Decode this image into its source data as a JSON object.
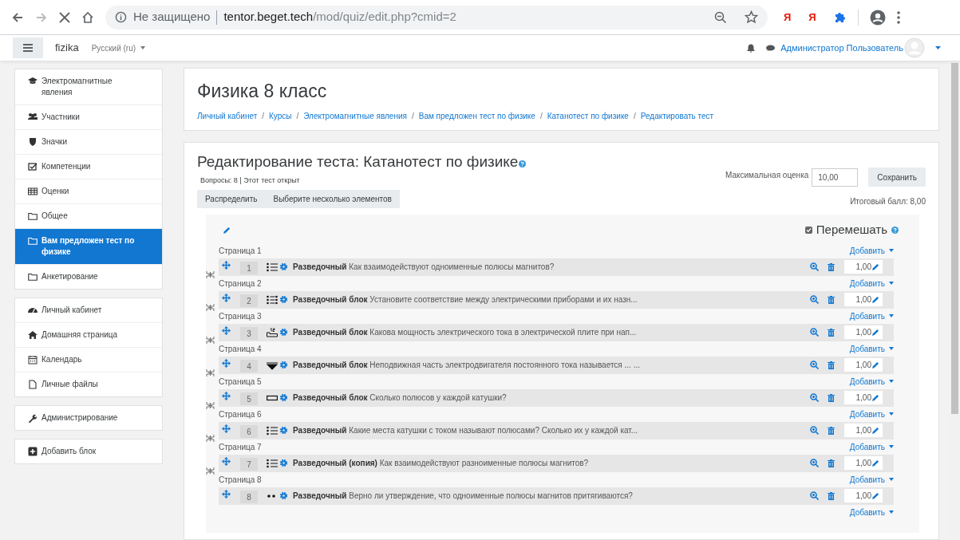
{
  "browser": {
    "security": "Не защищено",
    "host": "tentor.beget.tech",
    "path": "/mod/quiz/edit.php?cmid=2",
    "extensions": [
      {
        "label": "Я",
        "kind": "text"
      },
      {
        "label": "Я",
        "kind": "text"
      },
      {
        "kind": "puzzle"
      }
    ]
  },
  "navbar": {
    "site": "fizika",
    "language": "Русский (ru)",
    "user": "Администратор Пользователь"
  },
  "sidebar": {
    "groups": [
      {
        "items": [
          {
            "label": "Электромагнитные явления",
            "kind": "cap",
            "selected": false
          },
          {
            "label": "Участники",
            "kind": "users",
            "selected": false
          },
          {
            "label": "Значки",
            "kind": "shield",
            "selected": false
          },
          {
            "label": "Компетенции",
            "kind": "check",
            "selected": false
          },
          {
            "label": "Оценки",
            "kind": "table",
            "selected": false
          },
          {
            "label": "Общее",
            "kind": "folder",
            "selected": false
          },
          {
            "label": "Вам предложен тест по физике",
            "kind": "folder",
            "selected": true
          },
          {
            "label": "Анкетирование",
            "kind": "folder",
            "selected": false
          }
        ]
      },
      {
        "items": [
          {
            "label": "Личный кабинет",
            "kind": "gauge",
            "selected": false
          },
          {
            "label": "Домашняя страница",
            "kind": "home",
            "selected": false
          },
          {
            "label": "Календарь",
            "kind": "calendar",
            "selected": false
          },
          {
            "label": "Личные файлы",
            "kind": "file",
            "selected": false
          }
        ]
      },
      {
        "items": [
          {
            "label": "Администрирование",
            "kind": "wrench",
            "selected": false
          }
        ]
      },
      {
        "items": [
          {
            "label": "Добавить блок",
            "kind": "plus",
            "selected": false
          }
        ]
      }
    ]
  },
  "header": {
    "title": "Физика 8 класс",
    "breadcrumb_separator": "/",
    "breadcrumbs": [
      "Личный кабинет",
      "Курсы",
      "Электромагнитные явления",
      "Вам предложен тест по физике",
      "Катанотест по физике",
      "Редактировать тест"
    ]
  },
  "quiz": {
    "title": "Редактирование теста: Катанотест по физике",
    "summary": "Вопросы: 8 | Этот тест открыт",
    "buttons": [
      "Распределить",
      "Выберите несколько элементов"
    ],
    "max_grade_label": "Максимальная оценка",
    "max_grade": "10,00",
    "save": "Сохранить",
    "total": "Итоговый балл: 8,00",
    "shuffle": {
      "label": "Перемешать",
      "checked": true
    },
    "pages": [
      {
        "label": "Страница 1",
        "add": "Добавить",
        "question": {
          "number": "1",
          "kind": "multichoice",
          "name": "Разведочный",
          "text": "Как взаимодействуют одноименные полюсы магнитов?",
          "mark": "1,00"
        }
      },
      {
        "label": "Страница 2",
        "add": "Добавить",
        "question": {
          "number": "2",
          "kind": "match",
          "name": "Разведочный блок",
          "text": "Установите соответствие между электрическими приборами и их назн...",
          "mark": "1,00"
        }
      },
      {
        "label": "Страница 3",
        "add": "Добавить",
        "question": {
          "number": "3",
          "kind": "numerical",
          "name": "Разведочный блок",
          "text": "Какова мощность электрического тока в электрической плите при нап...",
          "mark": "1,00"
        }
      },
      {
        "label": "Страница 4",
        "add": "Добавить",
        "question": {
          "number": "4",
          "kind": "select",
          "name": "Разведочный блок",
          "text": "Неподвижная часть электродвигателя постоянного тока называется ... ...",
          "mark": "1,00"
        }
      },
      {
        "label": "Страница 5",
        "add": "Добавить",
        "question": {
          "number": "5",
          "kind": "shortanswer",
          "name": "Разведочный блок",
          "text": "Сколько полюсов у каждой катушки?",
          "mark": "1,00"
        }
      },
      {
        "label": "Страница 6",
        "add": "Добавить",
        "question": {
          "number": "6",
          "kind": "multichoice",
          "name": "Разведочный",
          "text": "Какие места катушки с током называют полюсами? Сколько их у каждой кат...",
          "mark": "1,00"
        }
      },
      {
        "label": "Страница 7",
        "add": "Добавить",
        "question": {
          "number": "7",
          "kind": "multichoice",
          "name": "Разведочный (копия)",
          "text": "Как взаимодействуют разноименные полюсы магнитов?",
          "mark": "1,00"
        }
      },
      {
        "label": "Страница 8",
        "add": "Добавить",
        "question": {
          "number": "8",
          "kind": "truefalse",
          "name": "Разведочный",
          "text": "Верно ли утверждение, что одноименные полюсы магнитов притягиваются?",
          "mark": "1,00"
        }
      }
    ],
    "add_last": "Добавить"
  }
}
